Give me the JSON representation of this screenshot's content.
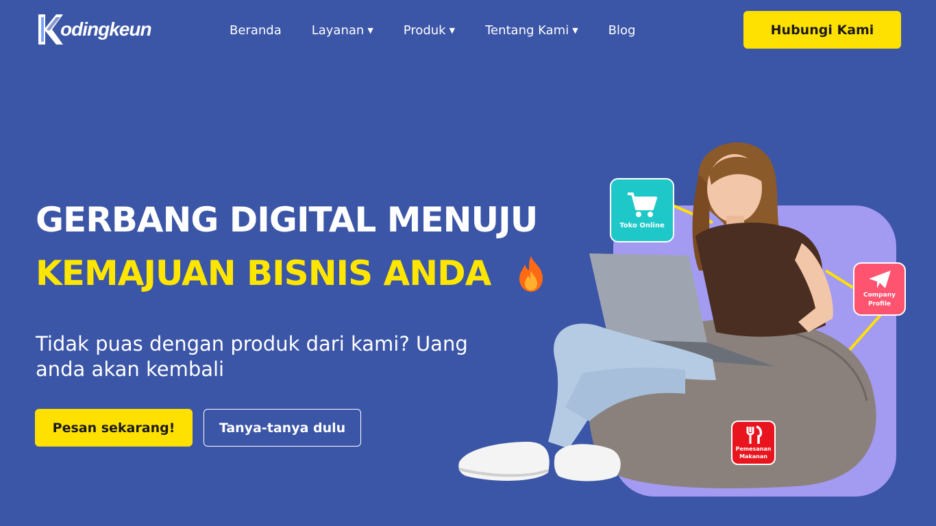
{
  "brand": {
    "name": "odingkeun",
    "logo_letter": "K"
  },
  "nav": {
    "items": [
      {
        "label": "Beranda",
        "has_dropdown": false
      },
      {
        "label": "Layanan",
        "has_dropdown": true
      },
      {
        "label": "Produk",
        "has_dropdown": true
      },
      {
        "label": "Tentang Kami",
        "has_dropdown": true
      },
      {
        "label": "Blog",
        "has_dropdown": false
      }
    ],
    "cta_label": "Hubungi Kami"
  },
  "hero": {
    "title_line1": "GERBANG DIGITAL MENUJU",
    "title_line2": "KEMAJUAN BISNIS ANDA",
    "subtitle": "Tidak puas dengan produk dari kami? Uang anda akan kembali",
    "primary_button": "Pesan sekarang!",
    "secondary_button": "Tanya-tanya dulu"
  },
  "illustration": {
    "tiles": [
      {
        "label": "Toko Online",
        "icon": "cart-icon",
        "color": "#1fc8c8"
      },
      {
        "label": "Company Profile",
        "icon": "paper-plane-icon",
        "color": "#ff5470"
      },
      {
        "label": "Pemesanan Makanan",
        "icon": "utensils-icon",
        "color": "#e8151f"
      }
    ]
  },
  "colors": {
    "background": "#3b55a7",
    "accent_yellow": "#ffe100",
    "panel_lavender": "#a39af2"
  }
}
